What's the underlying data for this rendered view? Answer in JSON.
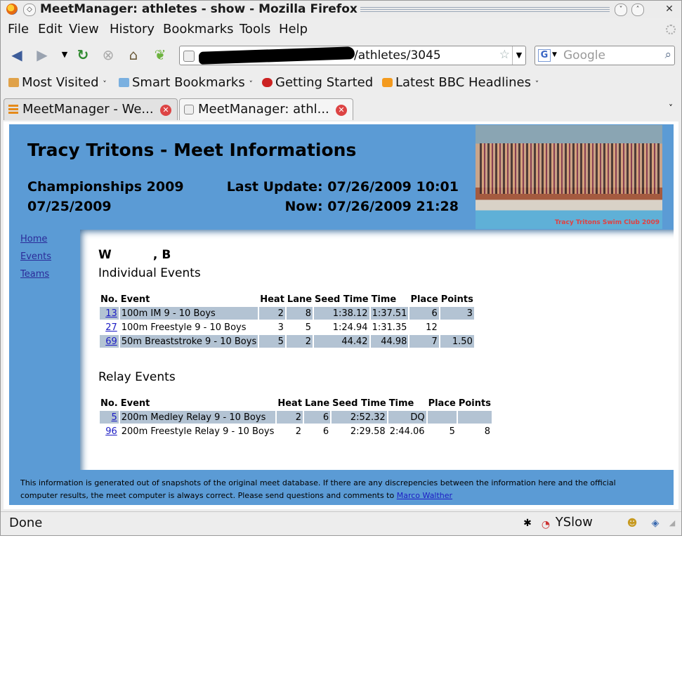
{
  "window": {
    "title": "MeetManager: athletes - show - Mozilla Firefox"
  },
  "menu": [
    "File",
    "Edit",
    "View",
    "History",
    "Bookmarks",
    "Tools",
    "Help"
  ],
  "navbar": {
    "url_visible": "/athletes/3045",
    "search_placeholder": "Google",
    "search_engine_glyph": "G"
  },
  "bookmarks": [
    "Most Visited",
    "Smart Bookmarks",
    "Getting Started",
    "Latest BBC Headlines"
  ],
  "tabs": [
    {
      "label": "MeetManager - We...",
      "active": false
    },
    {
      "label": "MeetManager: athl...",
      "active": true
    }
  ],
  "page": {
    "title": "Tracy Tritons - Meet Informations",
    "meet_name": "Championships 2009",
    "meet_date": "07/25/2009",
    "last_update": "Last Update: 07/26/2009 10:01",
    "now": "Now: 07/26/2009 21:28",
    "photo_caption": "Tracy Tritons Swim Club 2009",
    "nav": [
      "Home",
      "Events",
      "Teams"
    ],
    "athlete_name": "W          , B",
    "individual_heading": "Individual Events",
    "relay_heading": "Relay Events",
    "individual_columns": [
      "No.",
      "Event",
      "Heat",
      "Lane",
      "Seed Time",
      "Time",
      "Place",
      "Points"
    ],
    "individual_rows": [
      {
        "no": "13",
        "event": "100m IM 9 - 10 Boys",
        "heat": "2",
        "lane": "8",
        "seed": "1:38.12",
        "time": "1:37.51",
        "place": "6",
        "points": "3"
      },
      {
        "no": "27",
        "event": "100m Freestyle 9 - 10 Boys",
        "heat": "3",
        "lane": "5",
        "seed": "1:24.94",
        "time": "1:31.35",
        "place": "12",
        "points": ""
      },
      {
        "no": "69",
        "event": "50m Breaststroke 9 - 10 Boys",
        "heat": "5",
        "lane": "2",
        "seed": "44.42",
        "time": "44.98",
        "place": "7",
        "points": "1.50"
      }
    ],
    "relay_columns": [
      "No.",
      "Event",
      "Heat",
      "Lane",
      "Seed Time",
      "Time",
      "Place",
      "Points"
    ],
    "relay_rows": [
      {
        "no": "5",
        "event": "200m Medley Relay 9 - 10 Boys",
        "heat": "2",
        "lane": "6",
        "seed": "2:52.32",
        "time": "DQ",
        "place": "",
        "points": ""
      },
      {
        "no": "96",
        "event": "200m Freestyle Relay 9 - 10 Boys",
        "heat": "2",
        "lane": "6",
        "seed": "2:29.58",
        "time": "2:44.06",
        "place": "5",
        "points": "8"
      }
    ],
    "footer_text_1": "This information is generated out of snapshots of the original meet database. If there are any discrepencies between the information here and the official computer results, the meet computer is always correct. Please send questions and comments to ",
    "footer_link": "Marco Walther"
  },
  "status": {
    "text": "Done",
    "yslow": "YSlow"
  },
  "colors": {
    "page_blue": "#5b9bd5",
    "row_highlight": "#b3c3d3",
    "link": "#1c1cc4"
  }
}
